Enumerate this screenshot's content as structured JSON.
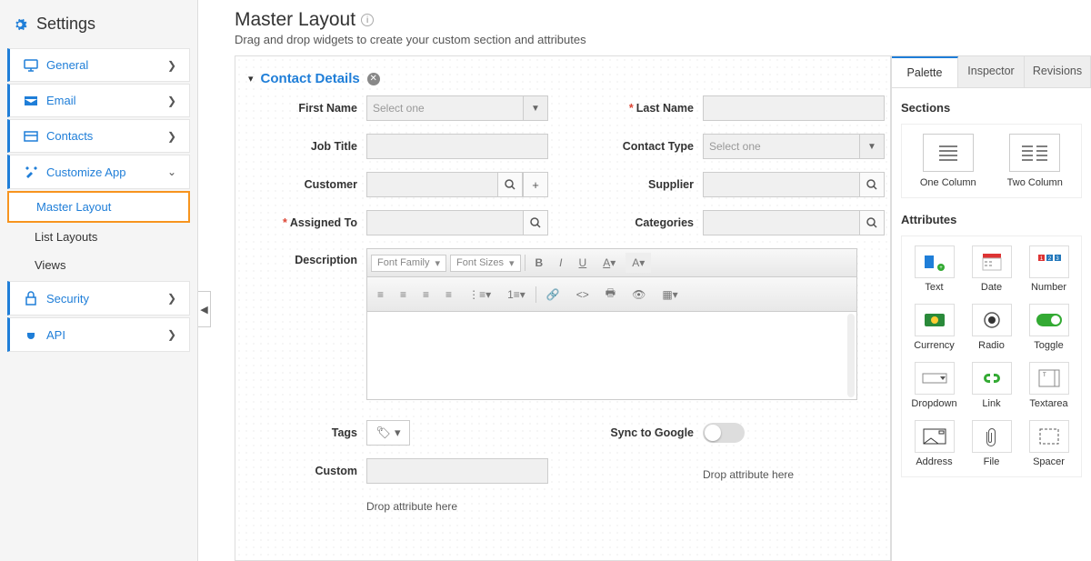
{
  "sidebar": {
    "title": "Settings",
    "items": [
      {
        "label": "General",
        "expanded": false
      },
      {
        "label": "Email",
        "expanded": false
      },
      {
        "label": "Contacts",
        "expanded": false
      },
      {
        "label": "Customize App",
        "expanded": true
      },
      {
        "label": "Security",
        "expanded": false
      },
      {
        "label": "API",
        "expanded": false
      }
    ],
    "customize_sub": [
      {
        "label": "Master Layout",
        "active": true
      },
      {
        "label": "List Layouts",
        "active": false
      },
      {
        "label": "Views",
        "active": false
      }
    ]
  },
  "header": {
    "title": "Master Layout",
    "subtitle": "Drag and drop widgets to create your custom section and attributes"
  },
  "section": {
    "title": "Contact Details"
  },
  "fields": {
    "first_name": {
      "label": "First Name",
      "placeholder": "Select one"
    },
    "last_name": {
      "label": "Last Name",
      "required": true
    },
    "job_title": {
      "label": "Job Title"
    },
    "contact_type": {
      "label": "Contact Type",
      "placeholder": "Select one"
    },
    "customer": {
      "label": "Customer"
    },
    "supplier": {
      "label": "Supplier"
    },
    "assigned_to": {
      "label": "Assigned To",
      "required": true
    },
    "categories": {
      "label": "Categories"
    },
    "description": {
      "label": "Description"
    },
    "tags": {
      "label": "Tags"
    },
    "sync": {
      "label": "Sync to Google"
    },
    "custom": {
      "label": "Custom"
    },
    "drop_hint": "Drop attribute here"
  },
  "rte": {
    "font_family": "Font Family",
    "font_sizes": "Font Sizes"
  },
  "right": {
    "tabs": [
      "Palette",
      "Inspector",
      "Revisions"
    ],
    "active_tab": "Palette",
    "sections_label": "Sections",
    "sections": [
      "One Column",
      "Two Column"
    ],
    "attributes_label": "Attributes",
    "attributes": [
      "Text",
      "Date",
      "Number",
      "Currency",
      "Radio",
      "Toggle",
      "Dropdown",
      "Link",
      "Textarea",
      "Address",
      "File",
      "Spacer"
    ]
  }
}
